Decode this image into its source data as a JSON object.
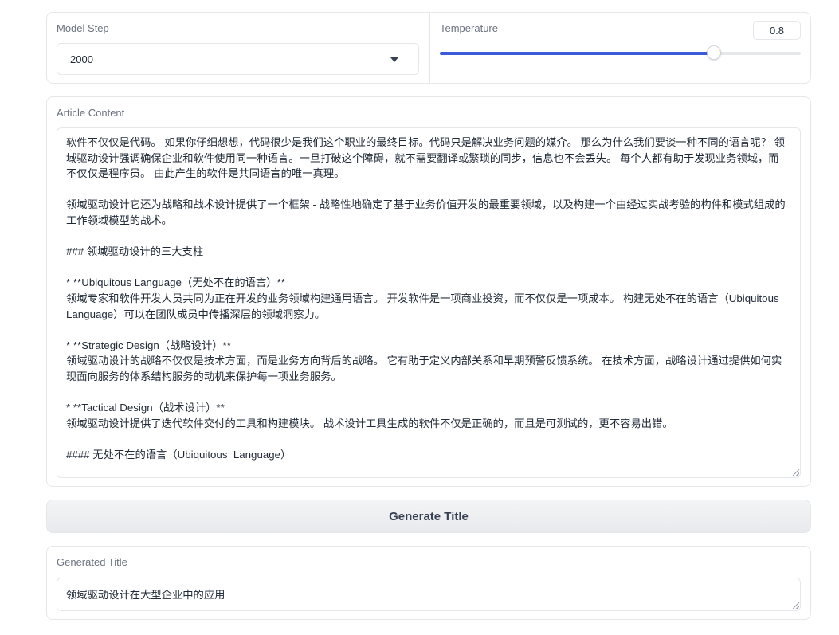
{
  "model_step": {
    "label": "Model Step",
    "selected_value": "2000"
  },
  "temperature": {
    "label": "Temperature",
    "value": "0.8",
    "slider_fraction": 0.76
  },
  "article": {
    "label": "Article Content",
    "content": "软件不仅仅是代码。 如果你仔细想想，代码很少是我们这个职业的最终目标。代码只是解决业务问题的媒介。 那么为什么我们要谈一种不同的语言呢？ 领域驱动设计强调确保企业和软件使用同一种语言。一旦打破这个障碍，就不需要翻译或繁琐的同步，信息也不会丢失。 每个人都有助于发现业务领域，而不仅仅是程序员。 由此产生的软件是共同语言的唯一真理。\n\n领域驱动设计它还为战略和战术设计提供了一个框架 - 战略性地确定了基于业务价值开发的最重要领域，以及构建一个由经过实战考验的构件和模式组成的工作领域模型的战术。\n\n### 领域驱动设计的三大支柱\n\n* **Ubiquitous Language（无处不在的语言）**\n领域专家和软件开发人员共同为正在开发的业务领域构建通用语言。 开发软件是一项商业投资，而不仅仅是一项成本。 构建无处不在的语言（Ubiquitous Language）可以在团队成员中传播深层的领域洞察力。\n\n* **Strategic Design（战略设计）**\n领域驱动设计的战略不仅仅是技术方面，而是业务方向背后的战略。 它有助于定义内部关系和早期预警反馈系统。 在技术方面，战略设计通过提供如何实现面向服务的体系结构服务的动机来保护每一项业务服务。\n\n* **Tactical Design（战术设计）**\n领域驱动设计提供了迭代软件交付的工具和构建模块。 战术设计工具生成的软件不仅是正确的，而且是可测试的，更不容易出错。\n\n#### 无处不在的语言（Ubiquitous  Language）"
  },
  "generate_button": {
    "label": "Generate Title"
  },
  "generated_title": {
    "label": "Generated Title",
    "value": "领域驱动设计在大型企业中的应用"
  },
  "colors": {
    "accent": "#3b5bdb",
    "border": "#e5e7eb",
    "label": "#6b7280"
  }
}
